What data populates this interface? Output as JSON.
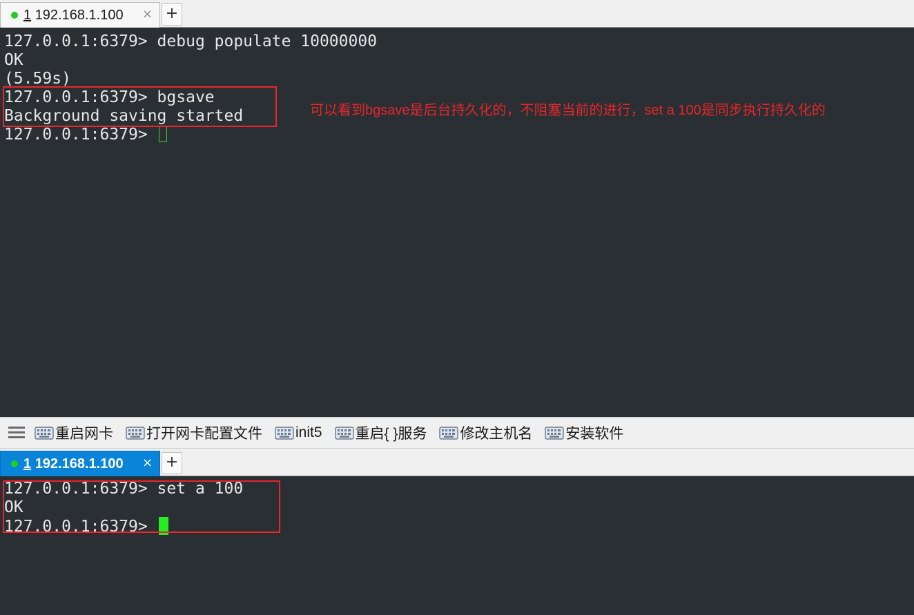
{
  "top_tab": {
    "number": "1",
    "host": "192.168.1.100",
    "close": "×",
    "new_tab": "+"
  },
  "top_terminal": {
    "lines": [
      "127.0.0.1:6379> debug populate 10000000",
      "OK",
      "(5.59s)",
      "127.0.0.1:6379> bgsave",
      "Background saving started",
      "127.0.0.1:6379> "
    ]
  },
  "annotation": "可以看到bgsave是后台持久化的，不阻塞当前的进行，set a 100是同步执行持久化的",
  "toolbar": {
    "items": [
      "重启网卡",
      "打开网卡配置文件",
      "init5",
      "重启{ }服务",
      "修改主机名",
      "安装软件"
    ]
  },
  "bottom_tab": {
    "number": "1",
    "host": "192.168.1.100",
    "close": "×",
    "new_tab": "+"
  },
  "bottom_terminal": {
    "lines": [
      "127.0.0.1:6379> set a 100",
      "OK",
      "127.0.0.1:6379> "
    ]
  },
  "colors": {
    "terminal_bg": "#2a2f33",
    "terminal_fg": "#e7e7e7",
    "annotation_red": "#e8262b",
    "active_tab_blue": "#0a84d8",
    "status_green": "#22cc22",
    "cursor_green": "#22ee22"
  }
}
